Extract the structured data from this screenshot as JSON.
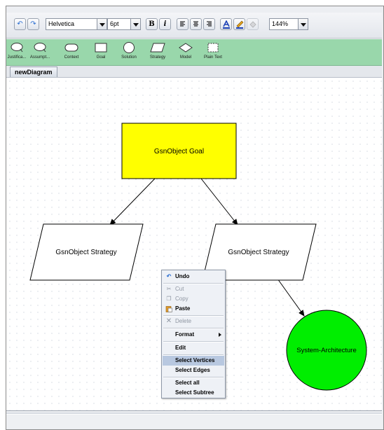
{
  "toolbar": {
    "font_family": "Helvetica",
    "font_size": "6pt",
    "bold_label": "B",
    "italic_label": "i",
    "zoom": "144%"
  },
  "palette": {
    "items": [
      {
        "label": "Justifica..."
      },
      {
        "label": "Assumpt..."
      },
      {
        "label": "Context"
      },
      {
        "label": "Goal"
      },
      {
        "label": "Solution"
      },
      {
        "label": "Strategy"
      },
      {
        "label": "Model"
      },
      {
        "label": "Plain Text"
      }
    ]
  },
  "tabs": [
    {
      "label": "newDiagram"
    }
  ],
  "diagram": {
    "goal_label": "GsnObject Goal",
    "strategy_left_label": "GsnObject Strategy",
    "strategy_right_label": "GsnObject Strategy",
    "solution_label": "System-Architecture",
    "colors": {
      "goal": "#ffff00",
      "solution": "#00ee00"
    }
  },
  "context_menu": {
    "items": [
      {
        "label": "Undo",
        "icon": "undo-icon",
        "enabled": true
      },
      {
        "label": "Cut",
        "icon": "cut-icon",
        "enabled": false
      },
      {
        "label": "Copy",
        "icon": "copy-icon",
        "enabled": false
      },
      {
        "label": "Paste",
        "icon": "paste-icon",
        "enabled": true
      },
      {
        "label": "Delete",
        "icon": "delete-icon",
        "enabled": false
      },
      {
        "label": "Format",
        "has_submenu": true,
        "enabled": true
      },
      {
        "label": "Edit",
        "enabled": true
      },
      {
        "label": "Select Vertices",
        "enabled": true,
        "highlighted": true
      },
      {
        "label": "Select Edges",
        "enabled": true
      },
      {
        "label": "Select all",
        "enabled": true
      },
      {
        "label": "Select Subtree",
        "enabled": true
      }
    ]
  }
}
